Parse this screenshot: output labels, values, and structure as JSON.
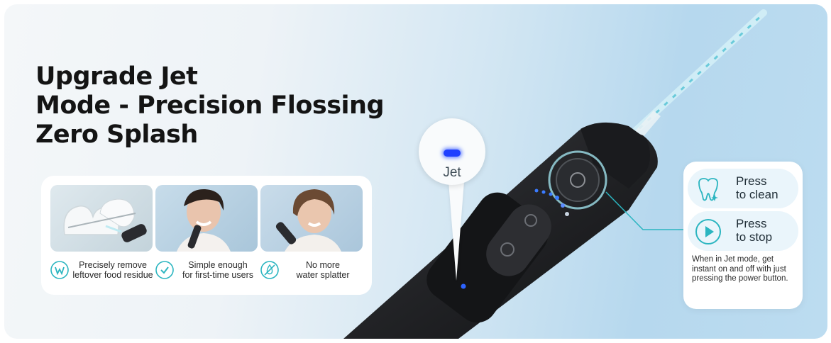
{
  "headline": {
    "line1": "Upgrade Jet",
    "line2": "Mode - Precision Flossing",
    "line3": "Zero Splash"
  },
  "features": [
    {
      "icon": "tooth-w-icon",
      "line1": "Precisely remove",
      "line2": "leftover food residue"
    },
    {
      "icon": "check-circle-icon",
      "line1": "Simple enough",
      "line2": "for first-time users"
    },
    {
      "icon": "no-splash-icon",
      "line1": "No more",
      "line2": "water splatter"
    }
  ],
  "mode_indicator": {
    "label": "Jet",
    "led_color": "#1f3fff"
  },
  "actions": [
    {
      "icon": "sparkle-tooth-icon",
      "line1": "Press",
      "line2": "to clean"
    },
    {
      "icon": "play-icon",
      "line1": "Press",
      "line2": "to stop"
    }
  ],
  "note": "When in Jet mode, get instant on and off with just pressing the power button.",
  "colors": {
    "accent": "#2bb5c0",
    "device": "#26272b",
    "background": "#cfe5f3",
    "headline": "#141414"
  }
}
